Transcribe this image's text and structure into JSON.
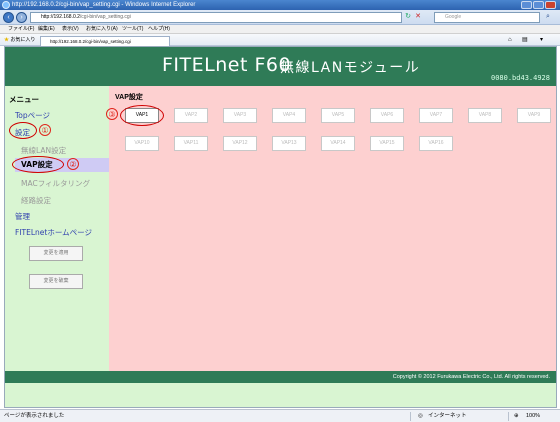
{
  "window": {
    "title": "http://192.168.0.2/cgi-bin/vap_setting.cgi - Windows Internet Explorer"
  },
  "address_bar": {
    "url_host": "http://192.168.0.2",
    "url_path": "/cgi-bin/vap_setting.cgi",
    "search_placeholder": "Google"
  },
  "menu": [
    "ファイル(F)",
    "編集(E)",
    "表示(V)",
    "お気に入り(A)",
    "ツール(T)",
    "ヘルプ(H)"
  ],
  "favorites": {
    "label": "お気に入り",
    "tab_title": "http://192.168.0.2/cgi-bin/vap_setting.cgi"
  },
  "header": {
    "title": "FITELnet F60",
    "subtitle": "無線LANモジュール",
    "device_id": "0080.bd43.4928"
  },
  "sidebar": {
    "menu_heading": "メニュー",
    "top_page": "Topページ",
    "settings": "設定",
    "wlan_settings": "無線LAN設定",
    "vap_settings": "VAP設定",
    "mac_filtering": "MACフィルタリング",
    "route_settings": "経路設定",
    "admin": "管理",
    "homepage": "FITELnetホームページ",
    "apply_button": "変更を適用",
    "discard_button": "変更を破棄"
  },
  "content": {
    "section_title": "VAP設定",
    "vaps_row1": [
      "VAP1",
      "VAP2",
      "VAP3",
      "VAP4",
      "VAP5",
      "VAP6",
      "VAP7",
      "VAP8",
      "VAP9"
    ],
    "vaps_row2": [
      "VAP10",
      "VAP11",
      "VAP12",
      "VAP13",
      "VAP14",
      "VAP15",
      "VAP16"
    ]
  },
  "callouts": [
    "①",
    "②",
    "③"
  ],
  "footer": {
    "copyright": "Copyright © 2012 Furukawa Electric Co., Ltd. All rights reserved."
  },
  "statusbar": {
    "status": "ページが表示されました",
    "zone": "インターネット",
    "zoom": "100%"
  }
}
